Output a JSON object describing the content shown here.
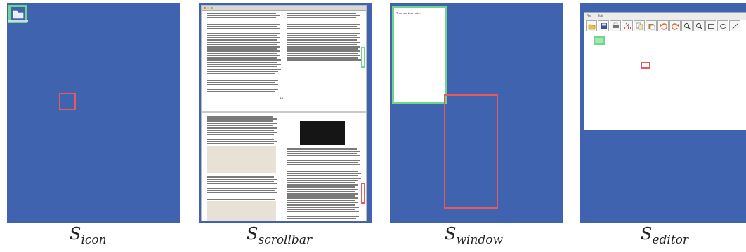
{
  "colors": {
    "desktop": "#3f63ae",
    "highlight_target": "#6fd58a",
    "highlight_cursor": "#e85a5a"
  },
  "panels": [
    {
      "symbol": "S",
      "subscript": "icon",
      "icon": "folder-icon"
    },
    {
      "symbol": "S",
      "subscript": "scrollbar",
      "page_number": "14"
    },
    {
      "symbol": "S",
      "subscript": "window",
      "window_text": "This is a test note."
    },
    {
      "symbol": "S",
      "subscript": "editor",
      "menu": [
        "File",
        "Edit"
      ],
      "tools": [
        "open-icon",
        "save-icon",
        "print-icon",
        "cut-icon",
        "copy-icon",
        "paste-icon",
        "undo-icon",
        "redo-icon",
        "zoom-in-icon",
        "zoom-out-icon",
        "rectangle-icon",
        "ellipse-icon",
        "line-icon"
      ]
    }
  ]
}
